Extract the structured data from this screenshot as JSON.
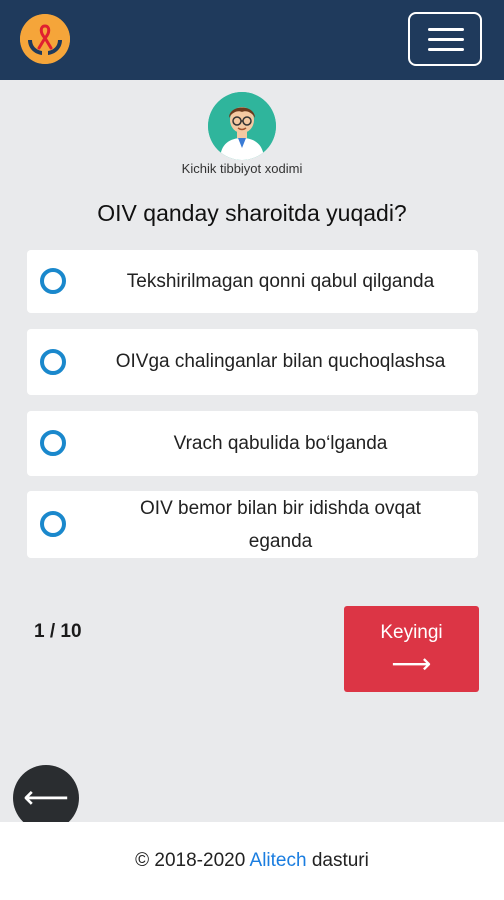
{
  "header": {
    "logo_icon": "hands-ribbon-logo-icon",
    "menu_icon": "hamburger-menu-icon"
  },
  "profile": {
    "avatar_icon": "doctor-avatar-icon",
    "role": "Kichik tibbiyot xodimi"
  },
  "quiz": {
    "question": "OIV qanday sharoitda yuqadi?",
    "options": [
      {
        "label": "Tekshirilmagan qonni qabul qilganda",
        "selected": false
      },
      {
        "label": "OIVga chalinganlar bilan quchoqlashsa",
        "selected": false
      },
      {
        "label": "Vrach qabulida bo‘lganda",
        "selected": false
      },
      {
        "label": "OIV bemor bilan bir idishda ovqat eganda",
        "selected": false
      }
    ],
    "counter": "1 / 10",
    "next_label": "Keyingi",
    "next_arrow": "⟶"
  },
  "back": {
    "arrow": "⟵"
  },
  "footer": {
    "prefix": "© 2018-2020 ",
    "brand": "Alitech",
    "suffix": " dasturi"
  },
  "colors": {
    "header_bg": "#1f3a5c",
    "radio": "#1a88cc",
    "next_button": "#dc3545",
    "link": "#1a7de0",
    "back_button": "#2a2d30"
  }
}
